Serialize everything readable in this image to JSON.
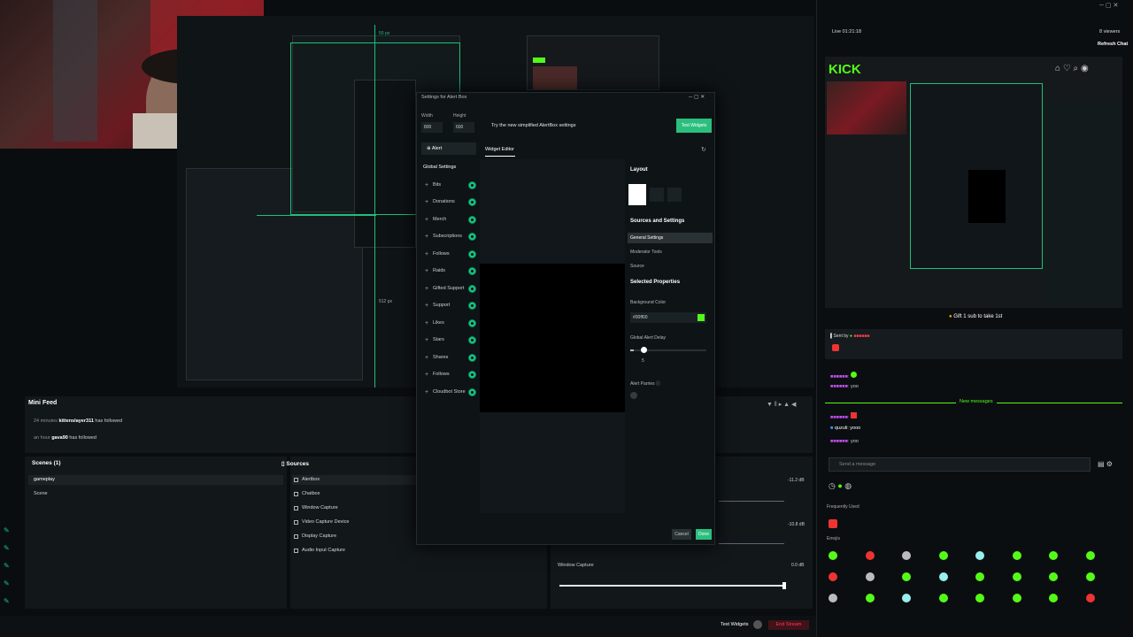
{
  "top_bar": {
    "live_time": "Live 01:21:18",
    "viewers": "8 viewers",
    "refresh_chat": "Refresh Chat"
  },
  "dialog": {
    "title": "Settings for Alert Box",
    "width_label": "Width",
    "width_value": "800",
    "height_label": "Height",
    "height_value": "600",
    "banner": "Try the new simplified AlertBox settings",
    "test_widgets": "Test Widgets",
    "tab_alert": "Alert",
    "widget_editor": "Widget Editor",
    "global_settings": "Global Settings",
    "alert_types": [
      "Bits",
      "Donations",
      "Merch",
      "Subscriptions",
      "Follows",
      "Raids",
      "Gifted Support",
      "Support",
      "Likes",
      "Stars",
      "Shares",
      "Follows",
      "Cloudbot Store"
    ],
    "layout_label": "Layout",
    "sources_and_settings": "Sources and Settings",
    "settings_nav": [
      "General Settings",
      "Moderator Tools",
      "Source"
    ],
    "selected_properties": "Selected Properties",
    "background_color_label": "Background Color",
    "background_color_value": "#00ff00",
    "global_alert_delay": "Global Alert Delay",
    "delay_value": "5",
    "delay_fraction": 0.05,
    "alert_parries": "Alert Parries",
    "cancel": "Cancel",
    "done": "Done",
    "px_top": "50 px",
    "px_side": "512 px"
  },
  "mini_feed": {
    "title": "Mini Feed",
    "items": [
      {
        "time": "24 minutes",
        "user": "kittenslayer311",
        "action": "has followed"
      },
      {
        "time": "an hour",
        "user": "gava90",
        "action": "has followed"
      }
    ]
  },
  "scenes": {
    "title": "Scenes (1)",
    "items": [
      "gameplay",
      "Scene"
    ]
  },
  "sources": {
    "title": "Sources",
    "items": [
      "Alertbox",
      "Chatbox",
      "Window Capture",
      "Video Capture Device",
      "Display Capture",
      "Audio Input Capture"
    ]
  },
  "mixer": {
    "levels": [
      "-11.2 dB",
      "-10.8 dB",
      "0.0 dB"
    ],
    "window_capture": "Window Capture"
  },
  "bottom_bar": {
    "test_widgets": "Test Widgets",
    "end_stream": "End Stream"
  },
  "chat": {
    "brand": "KICK",
    "gift_banner": "Gift 1 sub to take 1st",
    "sent_by": "Sent by",
    "new_messages": "New messages",
    "msg1": "yoo",
    "msg2_user": "quzuli",
    "msg2": "yooo",
    "msg3": "yoo",
    "send_placeholder": "Send a message",
    "frequently_used": "Frequently Used",
    "emojis_label": "Emojis"
  },
  "colors": {
    "accent": "#53fc18",
    "bg": "#0b0e10",
    "panel": "#12171a",
    "toggle": "#16c784",
    "end_stream": "#ff3b4d"
  }
}
